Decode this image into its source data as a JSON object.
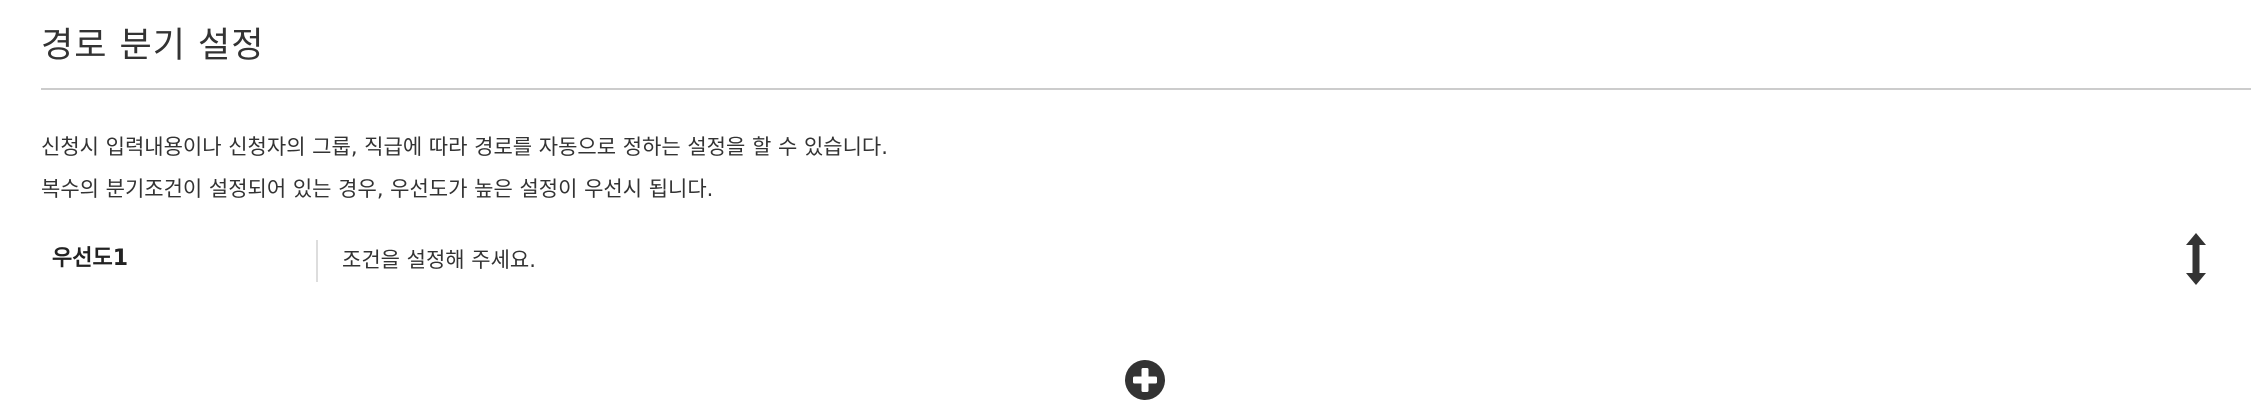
{
  "page": {
    "title": "경로 분기 설정"
  },
  "description": {
    "line1": "신청시 입력내용이나 신청자의 그룹, 직급에 따라 경로를 자동으로 정하는 설정을 할 수 있습니다.",
    "line2": "복수의 분기조건이 설정되어 있는 경우, 우선도가 높은 설정이 우선시 됩니다."
  },
  "rules": [
    {
      "priority_label": "우선도1",
      "condition_text": "조건을 설정해 주세요."
    }
  ],
  "icons": {
    "sort_handle": "vertical-resize-arrows-icon",
    "add": "plus-circle-icon"
  },
  "colors": {
    "text": "#333333",
    "divider": "#cccccc",
    "icon": "#333333"
  }
}
